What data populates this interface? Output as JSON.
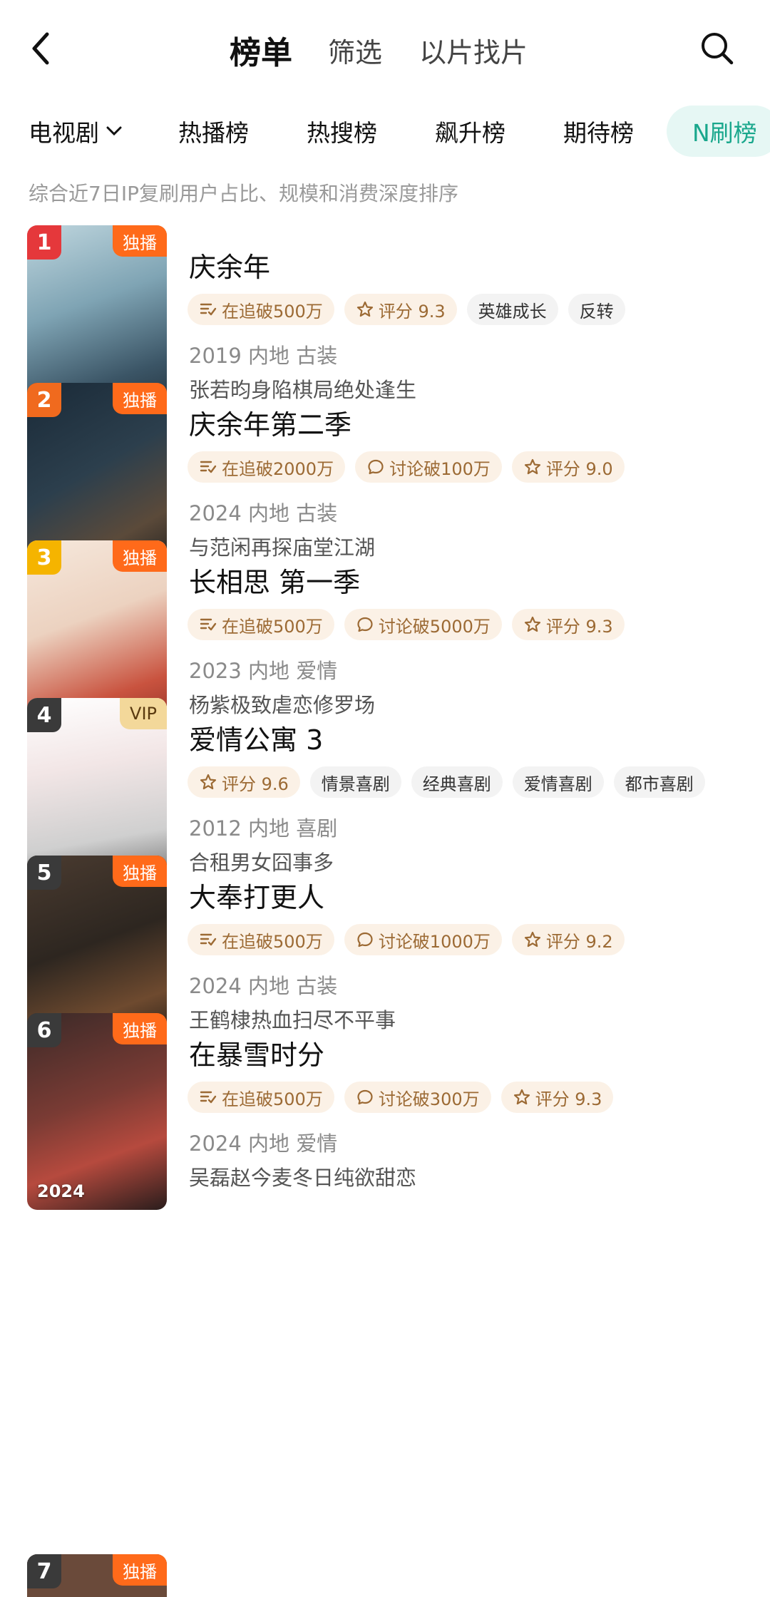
{
  "header": {
    "title": "榜单",
    "tab_filter": "筛选",
    "tab_search_by_image": "以片找片"
  },
  "category_tabs": {
    "dropdown_label": "电视剧",
    "tabs": [
      "热播榜",
      "热搜榜",
      "飙升榜",
      "期待榜",
      "N刷榜"
    ],
    "active": "N刷榜"
  },
  "description": "综合近7日IP复刷用户占比、规模和消费深度排序",
  "items": [
    {
      "rank": "1",
      "badge": "独播",
      "year": "2019",
      "title": "庆余年",
      "tags": [
        {
          "icon": "chase-icon",
          "label": "在追破500万"
        },
        {
          "icon": "star-icon",
          "label": "评分 9.3"
        },
        {
          "icon": "",
          "label": "英雄成长"
        },
        {
          "icon": "",
          "label": "反转"
        }
      ],
      "meta": "2019 内地 古装",
      "summary": "张若昀身陷棋局绝处逢生"
    },
    {
      "rank": "2",
      "badge": "独播",
      "year": "2024",
      "title": "庆余年第二季",
      "tags": [
        {
          "icon": "chase-icon",
          "label": "在追破2000万"
        },
        {
          "icon": "comment-icon",
          "label": "讨论破100万"
        },
        {
          "icon": "star-icon",
          "label": "评分 9.0"
        }
      ],
      "meta": "2024 内地 古装",
      "summary": "与范闲再探庙堂江湖"
    },
    {
      "rank": "3",
      "badge": "独播",
      "year": "2023",
      "title": "长相思 第一季",
      "tags": [
        {
          "icon": "chase-icon",
          "label": "在追破500万"
        },
        {
          "icon": "comment-icon",
          "label": "讨论破5000万"
        },
        {
          "icon": "star-icon",
          "label": "评分 9.3"
        }
      ],
      "meta": "2023 内地 爱情",
      "summary": "杨紫极致虐恋修罗场"
    },
    {
      "rank": "4",
      "badge": "VIP",
      "year": "2012",
      "title": "爱情公寓 3",
      "tags": [
        {
          "icon": "star-icon",
          "label": "评分 9.6"
        },
        {
          "icon": "",
          "label": "情景喜剧"
        },
        {
          "icon": "",
          "label": "经典喜剧"
        },
        {
          "icon": "",
          "label": "爱情喜剧"
        },
        {
          "icon": "",
          "label": "都市喜剧"
        }
      ],
      "meta": "2012 内地 喜剧",
      "summary": "合租男女囧事多"
    },
    {
      "rank": "5",
      "badge": "独播",
      "year": "2024",
      "title": "大奉打更人",
      "tags": [
        {
          "icon": "chase-icon",
          "label": "在追破500万"
        },
        {
          "icon": "comment-icon",
          "label": "讨论破1000万"
        },
        {
          "icon": "star-icon",
          "label": "评分 9.2"
        }
      ],
      "meta": "2024 内地 古装",
      "summary": "王鹤棣热血扫尽不平事"
    },
    {
      "rank": "6",
      "badge": "独播",
      "year": "2024",
      "title": "在暴雪时分",
      "tags": [
        {
          "icon": "chase-icon",
          "label": "在追破500万"
        },
        {
          "icon": "comment-icon",
          "label": "讨论破300万"
        },
        {
          "icon": "star-icon",
          "label": "评分 9.3"
        }
      ],
      "meta": "2024 内地 爱情",
      "summary": "吴磊赵今麦冬日纯欲甜恋"
    }
  ],
  "partial_item": {
    "rank": "7",
    "badge": "独播"
  },
  "colors": {
    "rank1": "#e5383b",
    "rank2": "#f06a1e",
    "rank3": "#f5b400",
    "rank_other": "#3a3a3a",
    "accent": "#19a78c"
  }
}
